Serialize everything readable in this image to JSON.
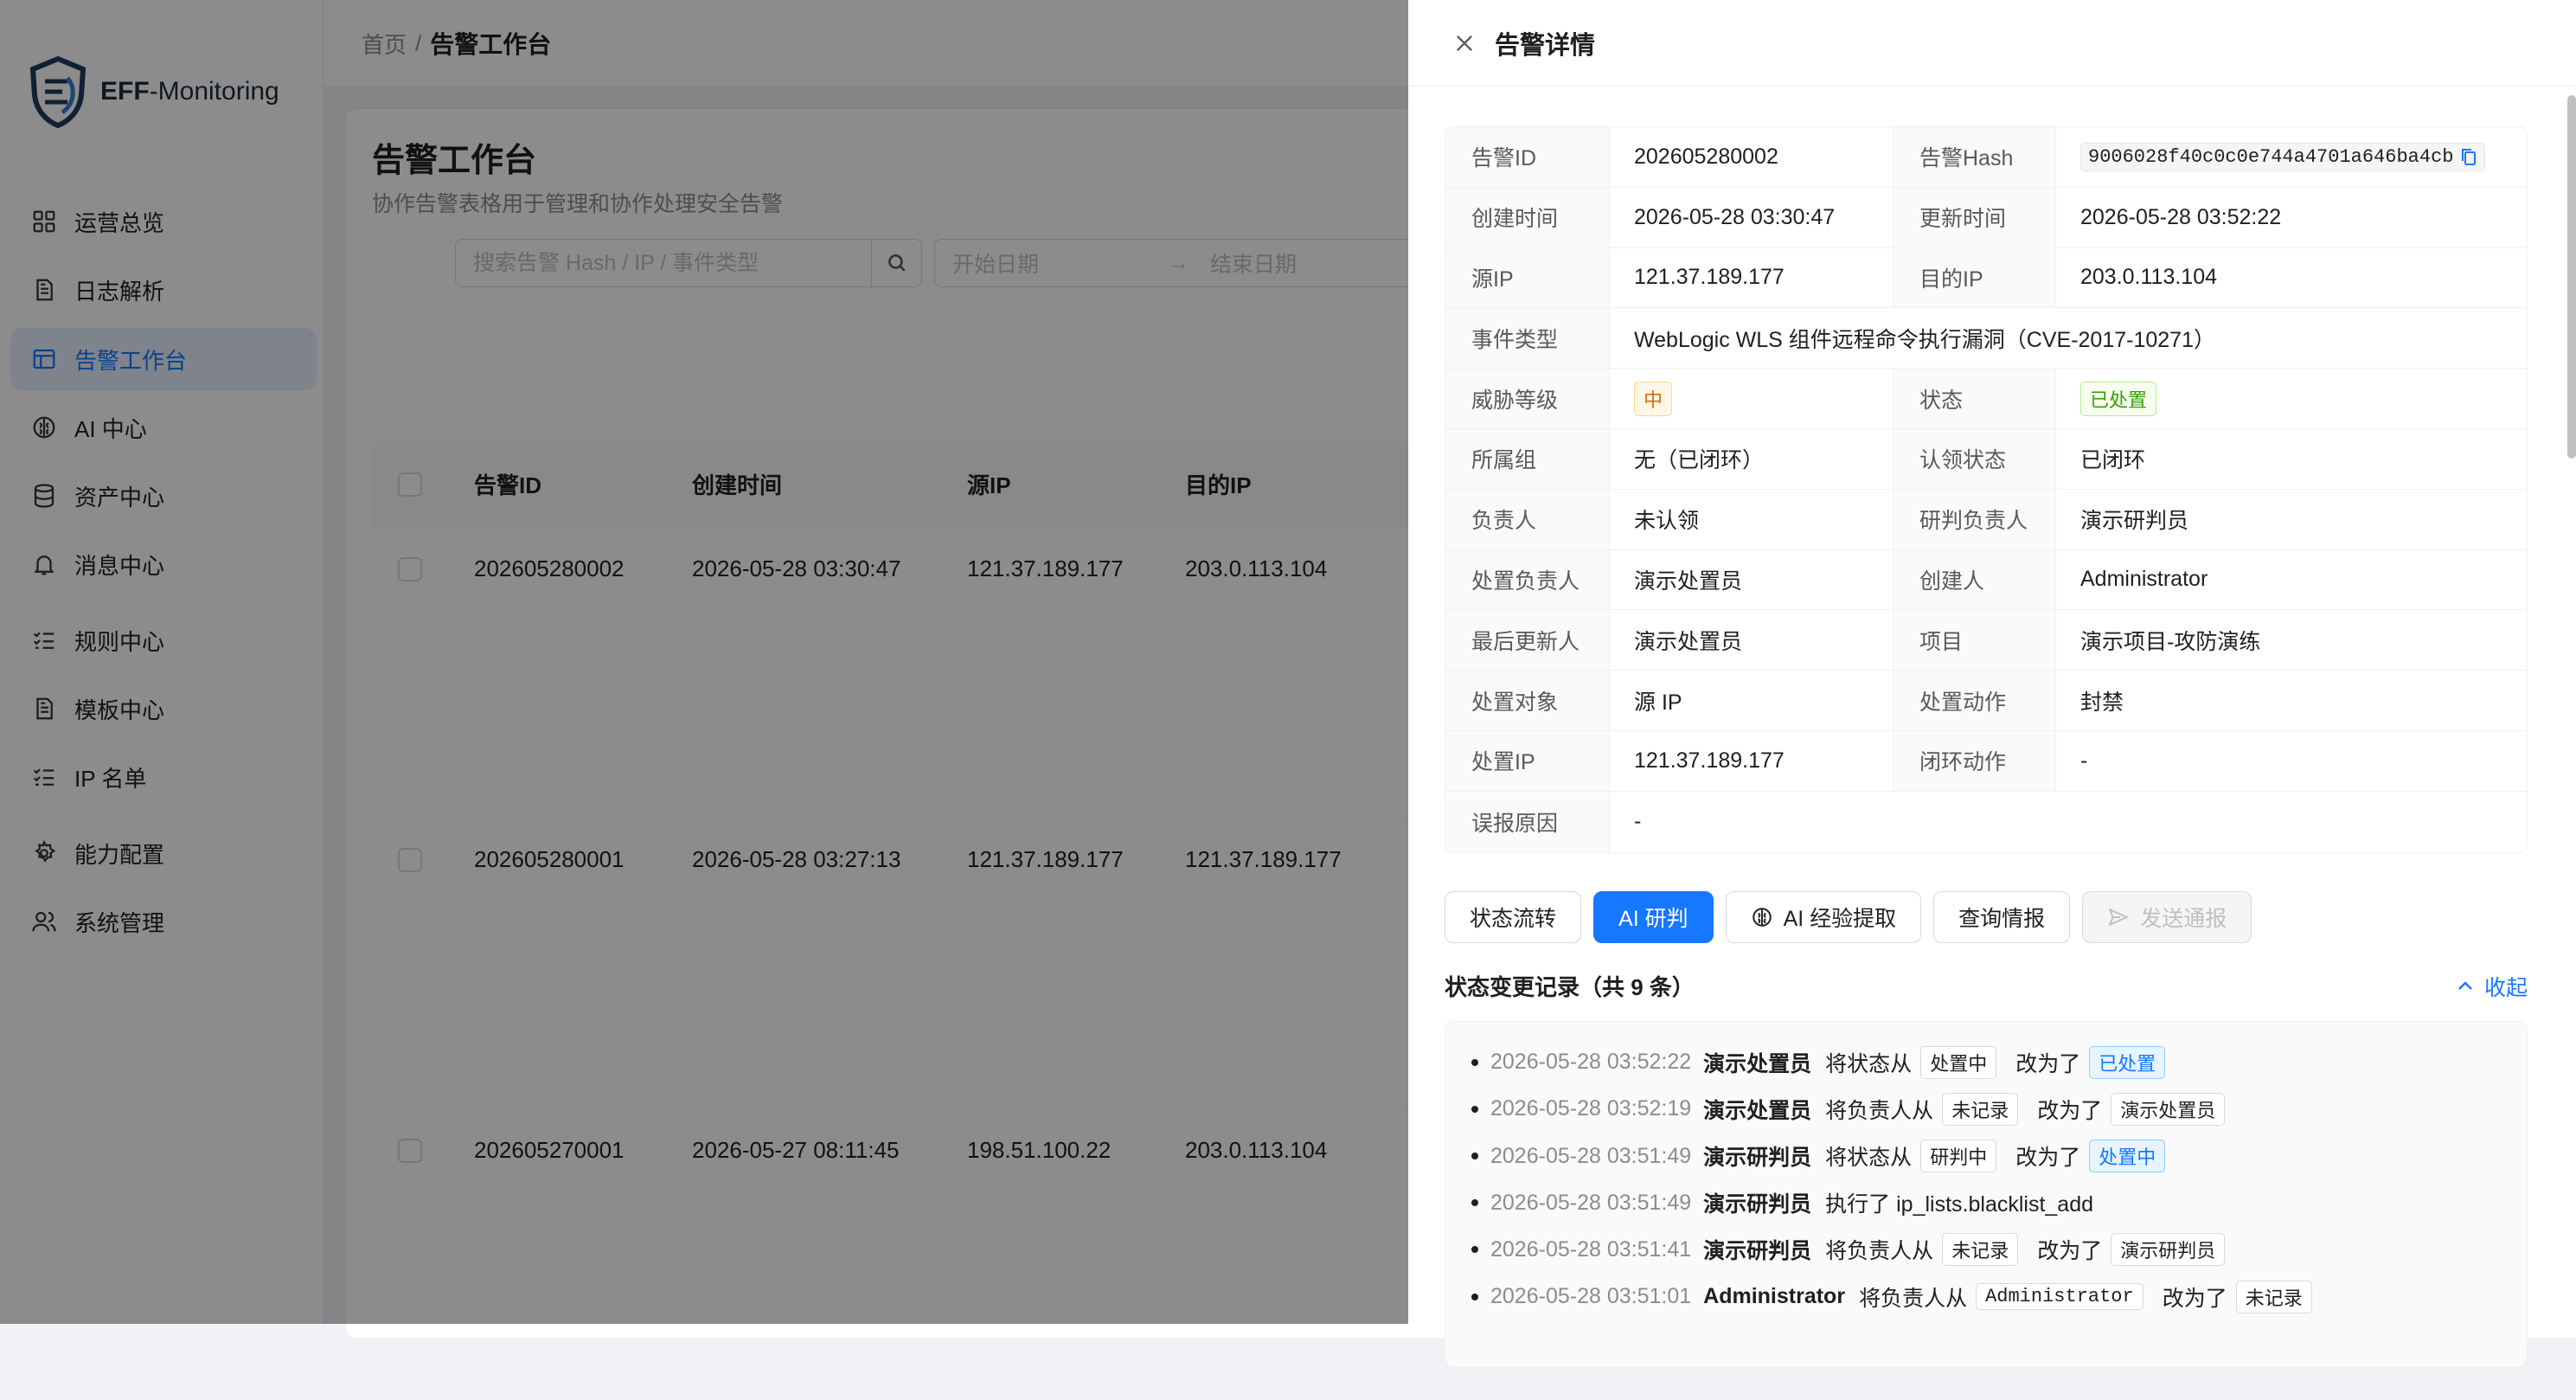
{
  "app": {
    "logo_brand": "EFF",
    "logo_suffix": "-Monitoring"
  },
  "sidebar": {
    "items": [
      {
        "label": "运营总览",
        "icon": "dashboard-icon"
      },
      {
        "label": "日志解析",
        "icon": "document-icon"
      },
      {
        "label": "告警工作台",
        "icon": "table-icon",
        "active": true
      },
      {
        "label": "AI 中心",
        "icon": "ai-brain-icon"
      },
      {
        "label": "资产中心",
        "icon": "database-icon"
      },
      {
        "label": "消息中心",
        "icon": "bell-icon"
      },
      {
        "label": "规则中心",
        "icon": "checklist-icon"
      },
      {
        "label": "模板中心",
        "icon": "document-icon"
      },
      {
        "label": "IP 名单",
        "icon": "checklist-icon"
      },
      {
        "label": "能力配置",
        "icon": "gear-icon"
      },
      {
        "label": "系统管理",
        "icon": "users-icon"
      }
    ]
  },
  "breadcrumb": {
    "home": "首页",
    "sep": "/",
    "current": "告警工作台"
  },
  "page": {
    "title": "告警工作台",
    "description": "协作告警表格用于管理和协作处理安全告警",
    "search_placeholder": "搜索告警 Hash / IP / 事件类型",
    "start_date_placeholder": "开始日期",
    "end_date_placeholder": "结束日期",
    "date_arrow": "→"
  },
  "table": {
    "columns": [
      "告警ID",
      "创建时间",
      "源IP",
      "目的IP"
    ],
    "rows": [
      {
        "id": "202605280002",
        "created": "2026-05-28 03:30:47",
        "src_ip": "121.37.189.177",
        "dst_ip": "203.0.113.104"
      },
      {
        "id": "202605280001",
        "created": "2026-05-28 03:27:13",
        "src_ip": "121.37.189.177",
        "dst_ip": "121.37.189.177"
      },
      {
        "id": "202605270001",
        "created": "2026-05-27 08:11:45",
        "src_ip": "198.51.100.22",
        "dst_ip": "203.0.113.104"
      }
    ]
  },
  "drawer": {
    "title": "告警详情",
    "fields": {
      "alert_id_label": "告警ID",
      "alert_id": "202605280002",
      "hash_label": "告警Hash",
      "hash": "9006028f40c0c0e744a4701a646ba4cb",
      "created_label": "创建时间",
      "created": "2026-05-28 03:30:47",
      "updated_label": "更新时间",
      "updated": "2026-05-28 03:52:22",
      "src_ip_label": "源IP",
      "src_ip": "121.37.189.177",
      "dst_ip_label": "目的IP",
      "dst_ip": "203.0.113.104",
      "event_type_label": "事件类型",
      "event_type": "WebLogic WLS 组件远程命令执行漏洞（CVE-2017-10271）",
      "threat_label": "威胁等级",
      "threat": "中",
      "status_label": "状态",
      "status": "已处置",
      "group_label": "所属组",
      "group": "无（已闭环）",
      "claim_label": "认领状态",
      "claim": "已闭环",
      "owner_label": "负责人",
      "owner": "未认领",
      "analyst_label": "研判负责人",
      "analyst": "演示研判员",
      "handler_label": "处置负责人",
      "handler": "演示处置员",
      "creator_label": "创建人",
      "creator": "Administrator",
      "last_updater_label": "最后更新人",
      "last_updater": "演示处置员",
      "project_label": "项目",
      "project": "演示项目-攻防演练",
      "target_label": "处置对象",
      "target": "源 IP",
      "action_label": "处置动作",
      "action": "封禁",
      "handle_ip_label": "处置IP",
      "handle_ip": "121.37.189.177",
      "close_action_label": "闭环动作",
      "close_action": "-",
      "false_reason_label": "误报原因",
      "false_reason": "-"
    },
    "buttons": {
      "status_flow": "状态流转",
      "ai_judge": "AI 研判",
      "ai_extract": "AI 经验提取",
      "query_intel": "查询情报",
      "send_notice": "发送通报"
    },
    "log_title": "状态变更记录（共 9 条）",
    "collapse_label": "收起",
    "log": [
      {
        "time": "2026-05-28 03:52:22",
        "user": "演示处置员",
        "action": "将状态从",
        "from": "处置中",
        "changed": "改为了",
        "to": "已处置",
        "to_style": "blue"
      },
      {
        "time": "2026-05-28 03:52:19",
        "user": "演示处置员",
        "action": "将负责人从",
        "from": "未记录",
        "changed": "改为了",
        "to": "演示处置员",
        "to_style": "plain"
      },
      {
        "time": "2026-05-28 03:51:49",
        "user": "演示研判员",
        "action": "将状态从",
        "from": "研判中",
        "changed": "改为了",
        "to": "处置中",
        "to_style": "blue"
      },
      {
        "time": "2026-05-28 03:51:49",
        "user": "演示研判员",
        "action": "执行了 ip_lists.blacklist_add",
        "from": "",
        "changed": "",
        "to": "",
        "to_style": "none"
      },
      {
        "time": "2026-05-28 03:51:41",
        "user": "演示研判员",
        "action": "将负责人从",
        "from": "未记录",
        "changed": "改为了",
        "to": "演示研判员",
        "to_style": "plain"
      },
      {
        "time": "2026-05-28 03:51:01",
        "user": "Administrator",
        "action": "将负责人从",
        "from": "Administrator",
        "changed": "改为了",
        "to": "未记录",
        "to_style": "plain",
        "from_mono": true
      }
    ]
  },
  "colors": {
    "primary": "#1677ff",
    "overlay": "rgba(0,0,0,0.45)",
    "tag_orange": "#d46b08",
    "tag_green": "#389e0d"
  }
}
